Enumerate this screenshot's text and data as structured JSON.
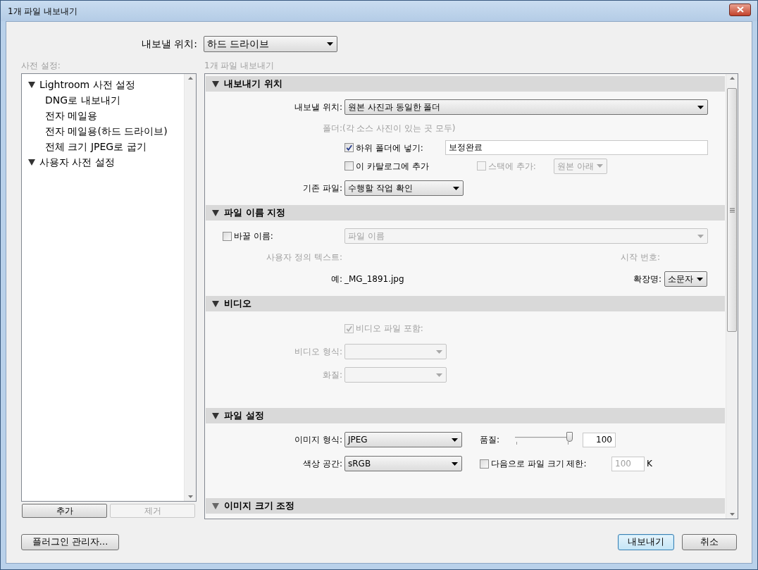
{
  "window": {
    "title": "1개 파일 내보내기"
  },
  "export_to": {
    "label": "내보낼 위치:",
    "value": "하드 드라이브"
  },
  "presets": {
    "caption": "사전 설정:",
    "tree": [
      {
        "label": "Lightroom 사전 설정",
        "expanded": true,
        "children": [
          {
            "label": "DNG로 내보내기"
          },
          {
            "label": "전자 메일용"
          },
          {
            "label": "전자 메일용(하드 드라이브)"
          },
          {
            "label": "전체 크기 JPEG로 굽기"
          }
        ]
      },
      {
        "label": "사용자 사전 설정",
        "expanded": true
      }
    ],
    "buttons": [
      {
        "label": "추가",
        "disabled": false
      },
      {
        "label": "제거",
        "disabled": true
      }
    ]
  },
  "panel": {
    "caption": "1개 파일 내보내기",
    "sections": [
      {
        "title": "내보내기 위치",
        "expanded": true,
        "rows": [
          {
            "label": "내보낼 위치:",
            "disabled": false,
            "controls": [
              {
                "kind": "dropdown",
                "value": "원본 사진과 동일한 폴더",
                "disabled": false
              }
            ]
          },
          {
            "label": "폴더:",
            "disabled": true,
            "controls": [
              {
                "kind": "text",
                "text": "(각 소스 사진이 있는 곳 모두)",
                "disabled": true
              }
            ]
          },
          {
            "controls": [
              {
                "kind": "checkbox",
                "label": "하위 폴더에 넣기:",
                "checked": true,
                "disabled": false
              },
              {
                "kind": "input",
                "value": "보정완료",
                "disabled": false
              }
            ]
          },
          {
            "controls": [
              {
                "kind": "checkbox",
                "label": "이 카탈로그에 추가",
                "checked": false,
                "disabled": false
              },
              {
                "kind": "checkbox",
                "label": "스택에 추가:",
                "checked": false,
                "disabled": true
              },
              {
                "kind": "dropdown",
                "value": "원본 아래",
                "disabled": true
              }
            ]
          },
          {
            "label": "기존 파일:",
            "disabled": false,
            "controls": [
              {
                "kind": "dropdown",
                "value": "수행할 작업 확인",
                "disabled": false
              }
            ]
          }
        ]
      },
      {
        "title": "파일 이름 지정",
        "expanded": true,
        "rows": [
          {
            "controls": [
              {
                "kind": "checkbox",
                "label": "바꿀 이름:",
                "checked": false,
                "disabled": false
              },
              {
                "kind": "dropdown",
                "value": "파일 이름",
                "disabled": true
              }
            ]
          },
          {
            "label": "사용자 정의 텍스트:",
            "disabled": true,
            "controls": [
              {
                "kind": "text",
                "text": "시작 번호:",
                "disabled": true
              }
            ]
          },
          {
            "label": "예:",
            "disabled": false,
            "controls": [
              {
                "kind": "text",
                "text": "_MG_1891.jpg",
                "disabled": false
              },
              {
                "kind": "text",
                "text": "확장명:",
                "disabled": false
              },
              {
                "kind": "dropdown",
                "value": "소문자",
                "disabled": false
              }
            ]
          }
        ]
      },
      {
        "title": "비디오",
        "expanded": true,
        "rows": [
          {
            "controls": [
              {
                "kind": "checkbox",
                "label": "비디오 파일 포함:",
                "checked": true,
                "disabled": true
              }
            ]
          },
          {
            "label": "비디오 형식:",
            "disabled": true,
            "controls": [
              {
                "kind": "dropdown",
                "disabled": true
              }
            ]
          },
          {
            "label": "화질:",
            "disabled": true,
            "controls": [
              {
                "kind": "dropdown",
                "disabled": true
              }
            ]
          }
        ]
      },
      {
        "title": "파일 설정",
        "expanded": true,
        "rows": [
          {
            "label": "이미지 형식:",
            "disabled": false,
            "controls": [
              {
                "kind": "dropdown",
                "value": "JPEG",
                "disabled": false
              },
              {
                "kind": "text",
                "text": "품질:",
                "disabled": false
              },
              {
                "kind": "slider",
                "level": 1,
                "disabled": false
              },
              {
                "kind": "input",
                "value": "100",
                "disabled": false
              }
            ]
          },
          {
            "label": "색상 공간:",
            "disabled": false,
            "controls": [
              {
                "kind": "dropdown",
                "value": "sRGB",
                "disabled": false
              },
              {
                "kind": "checkbox",
                "label": "다음으로 파일 크기 제한:",
                "checked": false,
                "disabled": false
              },
              {
                "kind": "input",
                "value": "100",
                "disabled": true
              },
              {
                "kind": "text",
                "text": "K",
                "disabled": false
              }
            ]
          }
        ]
      },
      {
        "title": "이미지 크기 조정",
        "expanded": true
      }
    ]
  },
  "footer": {
    "plugin_button": "플러그인 관리자...",
    "buttons": [
      {
        "label": "내보내기",
        "default": true
      },
      {
        "label": "취소",
        "default": false
      }
    ]
  }
}
